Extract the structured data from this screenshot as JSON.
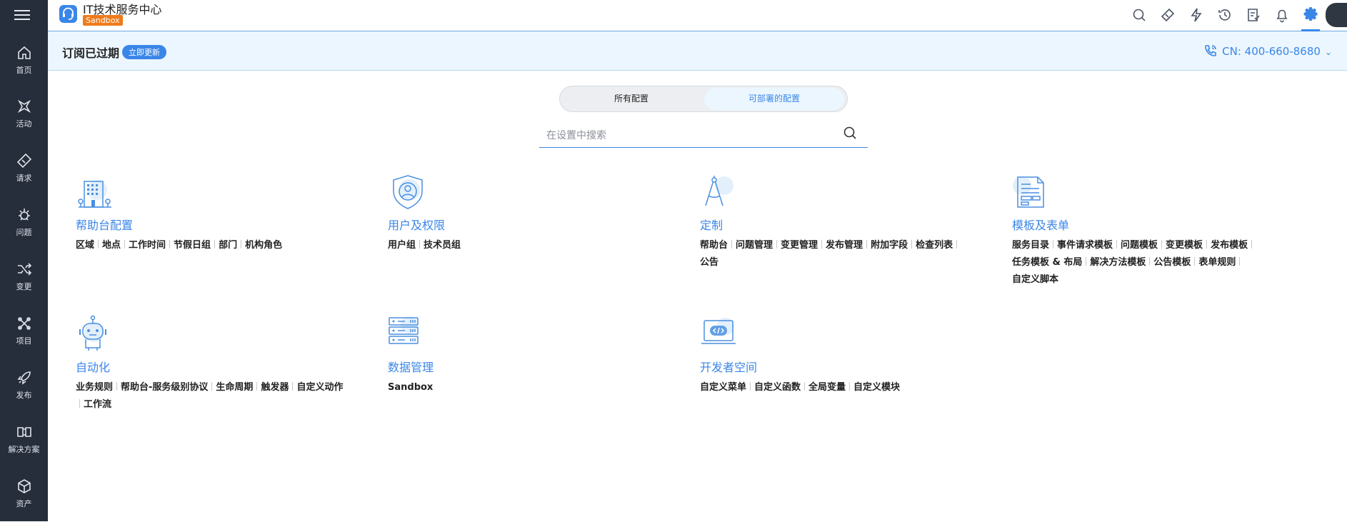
{
  "app": {
    "title": "IT技术服务中心",
    "badge": "Sandbox"
  },
  "sidebar": {
    "items": [
      {
        "label": "首页",
        "icon": "home-icon"
      },
      {
        "label": "活动",
        "icon": "activity-icon"
      },
      {
        "label": "请求",
        "icon": "ticket-icon"
      },
      {
        "label": "问题",
        "icon": "bug-icon"
      },
      {
        "label": "变更",
        "icon": "shuffle-icon"
      },
      {
        "label": "项目",
        "icon": "project-icon"
      },
      {
        "label": "发布",
        "icon": "rocket-icon"
      },
      {
        "label": "解决方案",
        "icon": "book-icon"
      },
      {
        "label": "资产",
        "icon": "cube-icon"
      }
    ]
  },
  "banner": {
    "title": "订阅已过期",
    "button": "立即更新",
    "phone": "CN: 400-660-8680"
  },
  "toggle": {
    "option1": "所有配置",
    "option2": "可部署的配置",
    "selected": "可部署的配置"
  },
  "search": {
    "placeholder": "在设置中搜索"
  },
  "colors": {
    "accent": "#3a86e8",
    "sidebar": "#262d3b",
    "banner": "#ebf6fe",
    "badge": "#f07a1a"
  },
  "sections": [
    {
      "title": "帮助台配置",
      "icon": "building-icon",
      "links": [
        "区域",
        "地点",
        "工作时间",
        "节假日组",
        "部门",
        "机构角色"
      ]
    },
    {
      "title": "用户及权限",
      "icon": "user-shield-icon",
      "links": [
        "用户组",
        "技术员组"
      ]
    },
    {
      "title": "定制",
      "icon": "compass-icon",
      "links": [
        "帮助台",
        "问题管理",
        "变更管理",
        "发布管理",
        "附加字段",
        "检查列表",
        "公告"
      ]
    },
    {
      "title": "模板及表单",
      "icon": "form-template-icon",
      "links": [
        "服务目录",
        "事件请求模板",
        "问题模板",
        "变更模板",
        "发布模板",
        "任务模板 & 布局",
        "解决方法模板",
        "公告模板",
        "表单规则",
        "自定义脚本"
      ]
    },
    {
      "title": "自动化",
      "icon": "robot-icon",
      "links": [
        "业务规则",
        "帮助台-服务级别协议",
        "生命周期",
        "触发器",
        "自定义动作",
        "工作流"
      ]
    },
    {
      "title": "数据管理",
      "icon": "server-icon",
      "links": [
        "Sandbox"
      ]
    },
    {
      "title": "开发者空间",
      "icon": "code-laptop-icon",
      "links": [
        "自定义菜单",
        "自定义函数",
        "全局变量",
        "自定义模块"
      ]
    }
  ]
}
